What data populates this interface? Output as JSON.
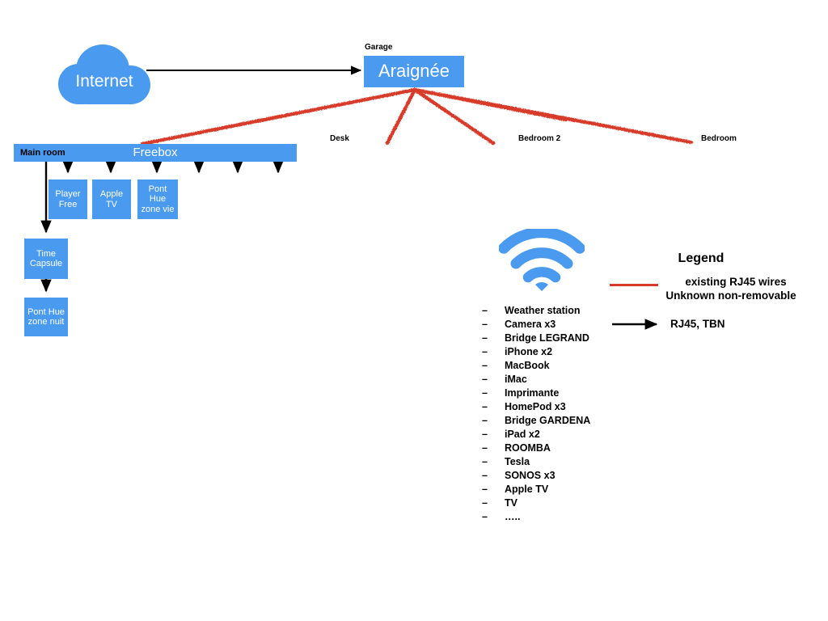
{
  "diagram": {
    "internet": {
      "label": "Internet"
    },
    "araignee": {
      "caption": "Garage",
      "label": "Araignée"
    },
    "freebox": {
      "room": "Main room",
      "label": "Freebox"
    },
    "devices": [
      {
        "id": "player-free",
        "label": "Player\nFree"
      },
      {
        "id": "apple-tv",
        "label": "Apple\nTV"
      },
      {
        "id": "pont-hue-vie",
        "label": "Pont\nHue\nzone vie"
      },
      {
        "id": "time-capsule",
        "label": "Time\nCapsule"
      },
      {
        "id": "pont-hue-nuit",
        "label": "Pont Hue\nzone nuit"
      }
    ],
    "rooms": [
      {
        "id": "desk",
        "label": "Desk"
      },
      {
        "id": "bedroom-2",
        "label": "Bedroom 2"
      },
      {
        "id": "bedroom",
        "label": "Bedroom"
      }
    ],
    "wifi_icon": "wifi-icon"
  },
  "device_list": {
    "bullet": "–",
    "items": [
      "Weather station",
      "Camera x3",
      "Bridge LEGRAND",
      "iPhone x2",
      "MacBook",
      "iMac",
      "Imprimante",
      "HomePod x3",
      "Bridge GARDENA",
      "iPad x2",
      "ROOMBA",
      "Tesla",
      "SONOS x3",
      "Apple TV",
      "TV",
      "….."
    ]
  },
  "legend": {
    "title": "Legend",
    "red_line_text": "existing RJ45 wires",
    "red_line_text_2": "Unknown non-removable",
    "arrow_text": "RJ45, TBN"
  },
  "colors": {
    "node_blue": "#4a9af0",
    "wire_red": "#d93b2b",
    "arrow_black": "#000000",
    "background": "#ffffff"
  }
}
